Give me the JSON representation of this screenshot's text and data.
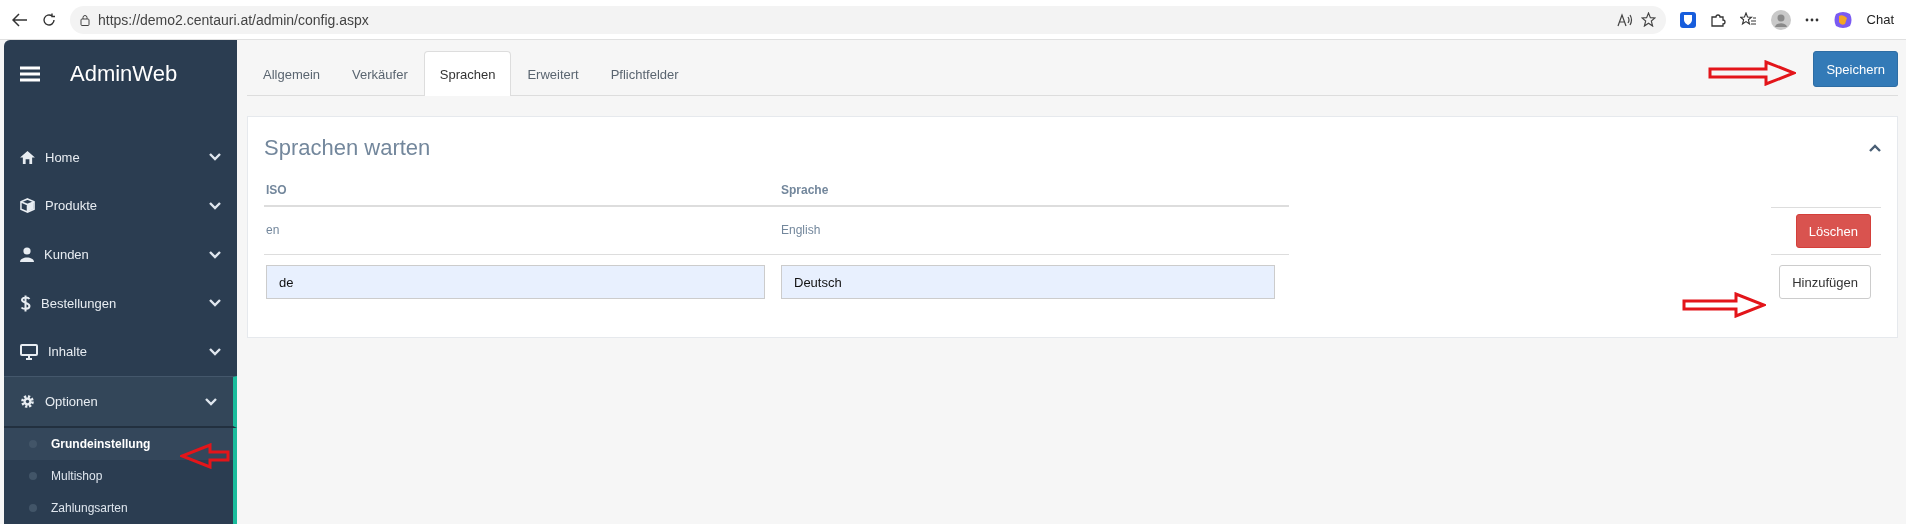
{
  "browser": {
    "url": "https://demo2.centauri.at/admin/config.aspx",
    "chat_label": "Chat"
  },
  "sidebar": {
    "brand": "AdminWeb",
    "items": [
      {
        "label": "Home",
        "selected": false,
        "expanded": false
      },
      {
        "label": "Produkte",
        "selected": false,
        "expanded": false
      },
      {
        "label": "Kunden",
        "selected": false,
        "expanded": false
      },
      {
        "label": "Bestellungen",
        "selected": false,
        "expanded": false
      },
      {
        "label": "Inhalte",
        "selected": false,
        "expanded": false
      },
      {
        "label": "Optionen",
        "selected": true,
        "expanded": true,
        "children": [
          {
            "label": "Grundeinstellung",
            "selected": true
          },
          {
            "label": "Multishop",
            "selected": false
          },
          {
            "label": "Zahlungsarten",
            "selected": false
          }
        ]
      }
    ]
  },
  "tabs": [
    {
      "label": "Allgemein",
      "selected": false
    },
    {
      "label": "Verkäufer",
      "selected": false
    },
    {
      "label": "Sprachen",
      "selected": true
    },
    {
      "label": "Erweitert",
      "selected": false
    },
    {
      "label": "Pflichtfelder",
      "selected": false
    }
  ],
  "save_button": "Speichern",
  "panel": {
    "title": "Sprachen warten",
    "columns": [
      "ISO",
      "Sprache"
    ],
    "rows": [
      {
        "iso": "en",
        "language": "English",
        "action": "Löschen"
      }
    ],
    "new_row": {
      "iso": "de",
      "language": "Deutsch",
      "action": "Hinzufügen"
    }
  }
}
